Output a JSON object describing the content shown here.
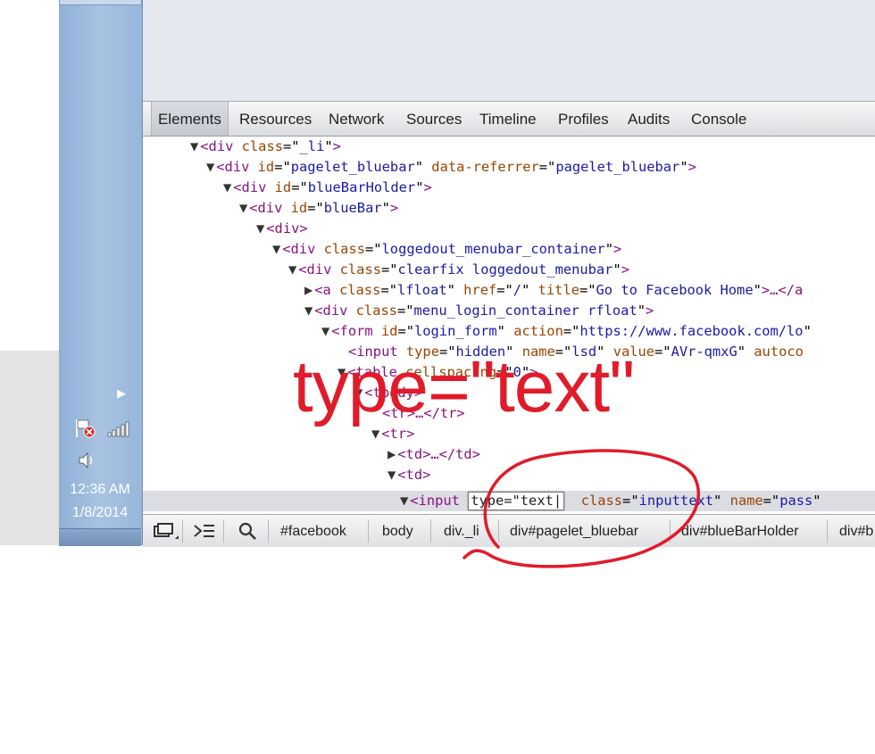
{
  "tray": {
    "time": "12:36 AM",
    "date": "1/8/2014",
    "icons": [
      "show-hidden-icons-arrow",
      "action-center-flag-icon",
      "network-signal-icon",
      "speaker-icon"
    ]
  },
  "devtools": {
    "tabs": [
      {
        "label": "Elements",
        "active": true
      },
      {
        "label": "Resources"
      },
      {
        "label": "Network"
      },
      {
        "label": "Sources"
      },
      {
        "label": "Timeline"
      },
      {
        "label": "Profiles"
      },
      {
        "label": "Audits"
      },
      {
        "label": "Console"
      }
    ],
    "dom_lines": [
      {
        "tri": "▼",
        "tag": "div",
        "attrs": [
          {
            "n": "class",
            "v": "_li"
          }
        ],
        "close": ">"
      },
      {
        "tri": "▼",
        "tag": "div",
        "attrs": [
          {
            "n": "id",
            "v": "pagelet_bluebar"
          },
          {
            "n": "data-referrer",
            "v": "pagelet_bluebar"
          }
        ],
        "close": ">"
      },
      {
        "tri": "▼",
        "tag": "div",
        "attrs": [
          {
            "n": "id",
            "v": "blueBarHolder"
          }
        ],
        "close": ">"
      },
      {
        "tri": "▼",
        "tag": "div",
        "attrs": [
          {
            "n": "id",
            "v": "blueBar"
          }
        ],
        "close": ">"
      },
      {
        "tri": "▼",
        "tag": "div",
        "attrs": [],
        "close": ">"
      },
      {
        "tri": "▼",
        "tag": "div",
        "attrs": [
          {
            "n": "class",
            "v": "loggedout_menubar_container"
          }
        ],
        "close": ">"
      },
      {
        "tri": "▼",
        "tag": "div",
        "attrs": [
          {
            "n": "class",
            "v": "clearfix loggedout_menubar"
          }
        ],
        "close": ">"
      },
      {
        "tri": "▶",
        "tag": "a",
        "attrs": [
          {
            "n": "class",
            "v": "lfloat"
          },
          {
            "n": "href",
            "v": "/"
          },
          {
            "n": "title",
            "v": "Go to Facebook Home"
          }
        ],
        "close": ">…</a"
      },
      {
        "tri": "▼",
        "tag": "div",
        "attrs": [
          {
            "n": "class",
            "v": "menu_login_container rfloat"
          }
        ],
        "close": ">"
      },
      {
        "tri": "▼",
        "tag": "form",
        "attrs": [
          {
            "n": "id",
            "v": "login_form"
          },
          {
            "n": "action",
            "v": "https://www.facebook.com/lo"
          }
        ],
        "close": ""
      },
      {
        "tri": "",
        "tag": "input",
        "attrs": [
          {
            "n": "type",
            "v": "hidden"
          },
          {
            "n": "name",
            "v": "lsd"
          },
          {
            "n": "value",
            "v": "AVr-qmxG"
          },
          {
            "n": "autoco",
            "v": null
          }
        ],
        "close": ""
      },
      {
        "tri": "▼",
        "tag": "table",
        "attrs": [
          {
            "n": "cellspacing",
            "v": "0"
          }
        ],
        "close": ">"
      },
      {
        "tri": "▼",
        "tag": "tbody",
        "attrs": [],
        "close": ">"
      },
      {
        "tri": "",
        "tag": "tr",
        "attrs": [],
        "close": ">…</tr>"
      },
      {
        "tri": "▼",
        "tag": "tr",
        "attrs": [],
        "close": ">"
      },
      {
        "tri": "▶",
        "tag": "td",
        "attrs": [],
        "close": ">…</td>"
      },
      {
        "tri": "▼",
        "tag": "td",
        "attrs": [],
        "close": ">"
      }
    ],
    "selected_line": {
      "tri": "▼",
      "tag": "input",
      "editing_value": "type=\"text",
      "rest_attrs": [
        {
          "n": "class",
          "v": "inputtext"
        },
        {
          "n": "name",
          "v": "pass"
        }
      ]
    },
    "breadcrumbs": [
      "#facebook",
      "body",
      "div._li",
      "div#pagelet_bluebar",
      "div#blueBarHolder",
      "div#b"
    ],
    "status_icons": [
      "dock-toggle-icon",
      "console-drawer-icon",
      "search-icon"
    ]
  },
  "annotation": {
    "text": "type=\"text\"",
    "color": "#e01b2a"
  }
}
